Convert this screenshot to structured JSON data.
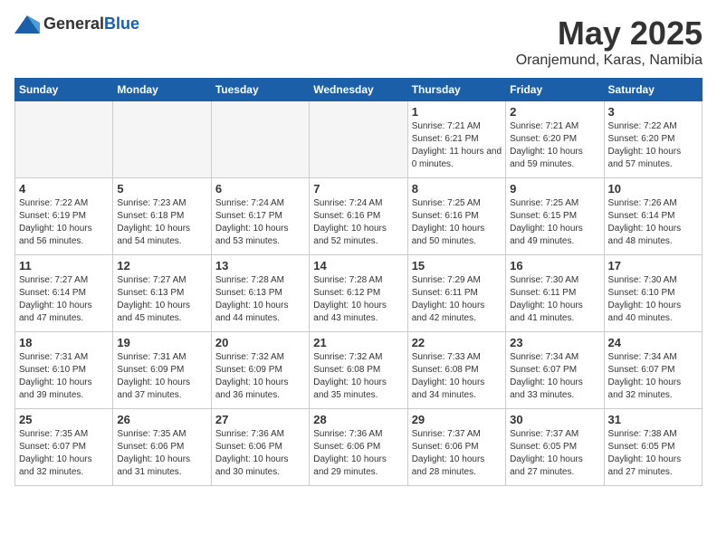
{
  "header": {
    "logo_general": "General",
    "logo_blue": "Blue",
    "month_title": "May 2025",
    "location": "Oranjemund, Karas, Namibia"
  },
  "weekdays": [
    "Sunday",
    "Monday",
    "Tuesday",
    "Wednesday",
    "Thursday",
    "Friday",
    "Saturday"
  ],
  "weeks": [
    [
      {
        "day": "",
        "empty": true
      },
      {
        "day": "",
        "empty": true
      },
      {
        "day": "",
        "empty": true
      },
      {
        "day": "",
        "empty": true
      },
      {
        "day": "1",
        "sunrise": "7:21 AM",
        "sunset": "6:21 PM",
        "daylight": "11 hours and 0 minutes."
      },
      {
        "day": "2",
        "sunrise": "7:21 AM",
        "sunset": "6:20 PM",
        "daylight": "10 hours and 59 minutes."
      },
      {
        "day": "3",
        "sunrise": "7:22 AM",
        "sunset": "6:20 PM",
        "daylight": "10 hours and 57 minutes."
      }
    ],
    [
      {
        "day": "4",
        "sunrise": "7:22 AM",
        "sunset": "6:19 PM",
        "daylight": "10 hours and 56 minutes."
      },
      {
        "day": "5",
        "sunrise": "7:23 AM",
        "sunset": "6:18 PM",
        "daylight": "10 hours and 54 minutes."
      },
      {
        "day": "6",
        "sunrise": "7:24 AM",
        "sunset": "6:17 PM",
        "daylight": "10 hours and 53 minutes."
      },
      {
        "day": "7",
        "sunrise": "7:24 AM",
        "sunset": "6:16 PM",
        "daylight": "10 hours and 52 minutes."
      },
      {
        "day": "8",
        "sunrise": "7:25 AM",
        "sunset": "6:16 PM",
        "daylight": "10 hours and 50 minutes."
      },
      {
        "day": "9",
        "sunrise": "7:25 AM",
        "sunset": "6:15 PM",
        "daylight": "10 hours and 49 minutes."
      },
      {
        "day": "10",
        "sunrise": "7:26 AM",
        "sunset": "6:14 PM",
        "daylight": "10 hours and 48 minutes."
      }
    ],
    [
      {
        "day": "11",
        "sunrise": "7:27 AM",
        "sunset": "6:14 PM",
        "daylight": "10 hours and 47 minutes."
      },
      {
        "day": "12",
        "sunrise": "7:27 AM",
        "sunset": "6:13 PM",
        "daylight": "10 hours and 45 minutes."
      },
      {
        "day": "13",
        "sunrise": "7:28 AM",
        "sunset": "6:13 PM",
        "daylight": "10 hours and 44 minutes."
      },
      {
        "day": "14",
        "sunrise": "7:28 AM",
        "sunset": "6:12 PM",
        "daylight": "10 hours and 43 minutes."
      },
      {
        "day": "15",
        "sunrise": "7:29 AM",
        "sunset": "6:11 PM",
        "daylight": "10 hours and 42 minutes."
      },
      {
        "day": "16",
        "sunrise": "7:30 AM",
        "sunset": "6:11 PM",
        "daylight": "10 hours and 41 minutes."
      },
      {
        "day": "17",
        "sunrise": "7:30 AM",
        "sunset": "6:10 PM",
        "daylight": "10 hours and 40 minutes."
      }
    ],
    [
      {
        "day": "18",
        "sunrise": "7:31 AM",
        "sunset": "6:10 PM",
        "daylight": "10 hours and 39 minutes."
      },
      {
        "day": "19",
        "sunrise": "7:31 AM",
        "sunset": "6:09 PM",
        "daylight": "10 hours and 37 minutes."
      },
      {
        "day": "20",
        "sunrise": "7:32 AM",
        "sunset": "6:09 PM",
        "daylight": "10 hours and 36 minutes."
      },
      {
        "day": "21",
        "sunrise": "7:32 AM",
        "sunset": "6:08 PM",
        "daylight": "10 hours and 35 minutes."
      },
      {
        "day": "22",
        "sunrise": "7:33 AM",
        "sunset": "6:08 PM",
        "daylight": "10 hours and 34 minutes."
      },
      {
        "day": "23",
        "sunrise": "7:34 AM",
        "sunset": "6:07 PM",
        "daylight": "10 hours and 33 minutes."
      },
      {
        "day": "24",
        "sunrise": "7:34 AM",
        "sunset": "6:07 PM",
        "daylight": "10 hours and 32 minutes."
      }
    ],
    [
      {
        "day": "25",
        "sunrise": "7:35 AM",
        "sunset": "6:07 PM",
        "daylight": "10 hours and 32 minutes."
      },
      {
        "day": "26",
        "sunrise": "7:35 AM",
        "sunset": "6:06 PM",
        "daylight": "10 hours and 31 minutes."
      },
      {
        "day": "27",
        "sunrise": "7:36 AM",
        "sunset": "6:06 PM",
        "daylight": "10 hours and 30 minutes."
      },
      {
        "day": "28",
        "sunrise": "7:36 AM",
        "sunset": "6:06 PM",
        "daylight": "10 hours and 29 minutes."
      },
      {
        "day": "29",
        "sunrise": "7:37 AM",
        "sunset": "6:06 PM",
        "daylight": "10 hours and 28 minutes."
      },
      {
        "day": "30",
        "sunrise": "7:37 AM",
        "sunset": "6:05 PM",
        "daylight": "10 hours and 27 minutes."
      },
      {
        "day": "31",
        "sunrise": "7:38 AM",
        "sunset": "6:05 PM",
        "daylight": "10 hours and 27 minutes."
      }
    ]
  ],
  "labels": {
    "sunrise": "Sunrise:",
    "sunset": "Sunset:",
    "daylight": "Daylight:"
  }
}
